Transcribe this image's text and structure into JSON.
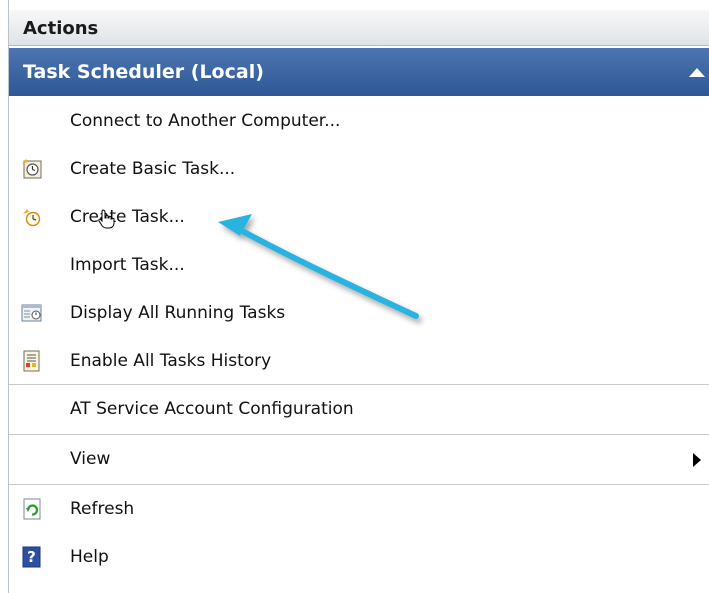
{
  "panel": {
    "header": "Actions",
    "section_title": "Task Scheduler (Local)"
  },
  "items": [
    {
      "label": "Connect to Another Computer...",
      "icon": "none"
    },
    {
      "label": "Create Basic Task...",
      "icon": "basic-task-icon"
    },
    {
      "label": "Create Task...",
      "icon": "create-task-icon"
    },
    {
      "label": "Import Task...",
      "icon": "none"
    },
    {
      "label": "Display All Running Tasks",
      "icon": "running-tasks-icon"
    },
    {
      "label": "Enable All Tasks History",
      "icon": "task-history-icon"
    },
    {
      "label": "AT Service Account Configuration",
      "icon": "none"
    },
    {
      "label": "View",
      "icon": "none",
      "submenu": true
    },
    {
      "label": "Refresh",
      "icon": "refresh-icon"
    },
    {
      "label": "Help",
      "icon": "help-icon"
    }
  ],
  "colors": {
    "section_header": "#2d5796",
    "annotation_arrow": "#2ab3e0"
  }
}
